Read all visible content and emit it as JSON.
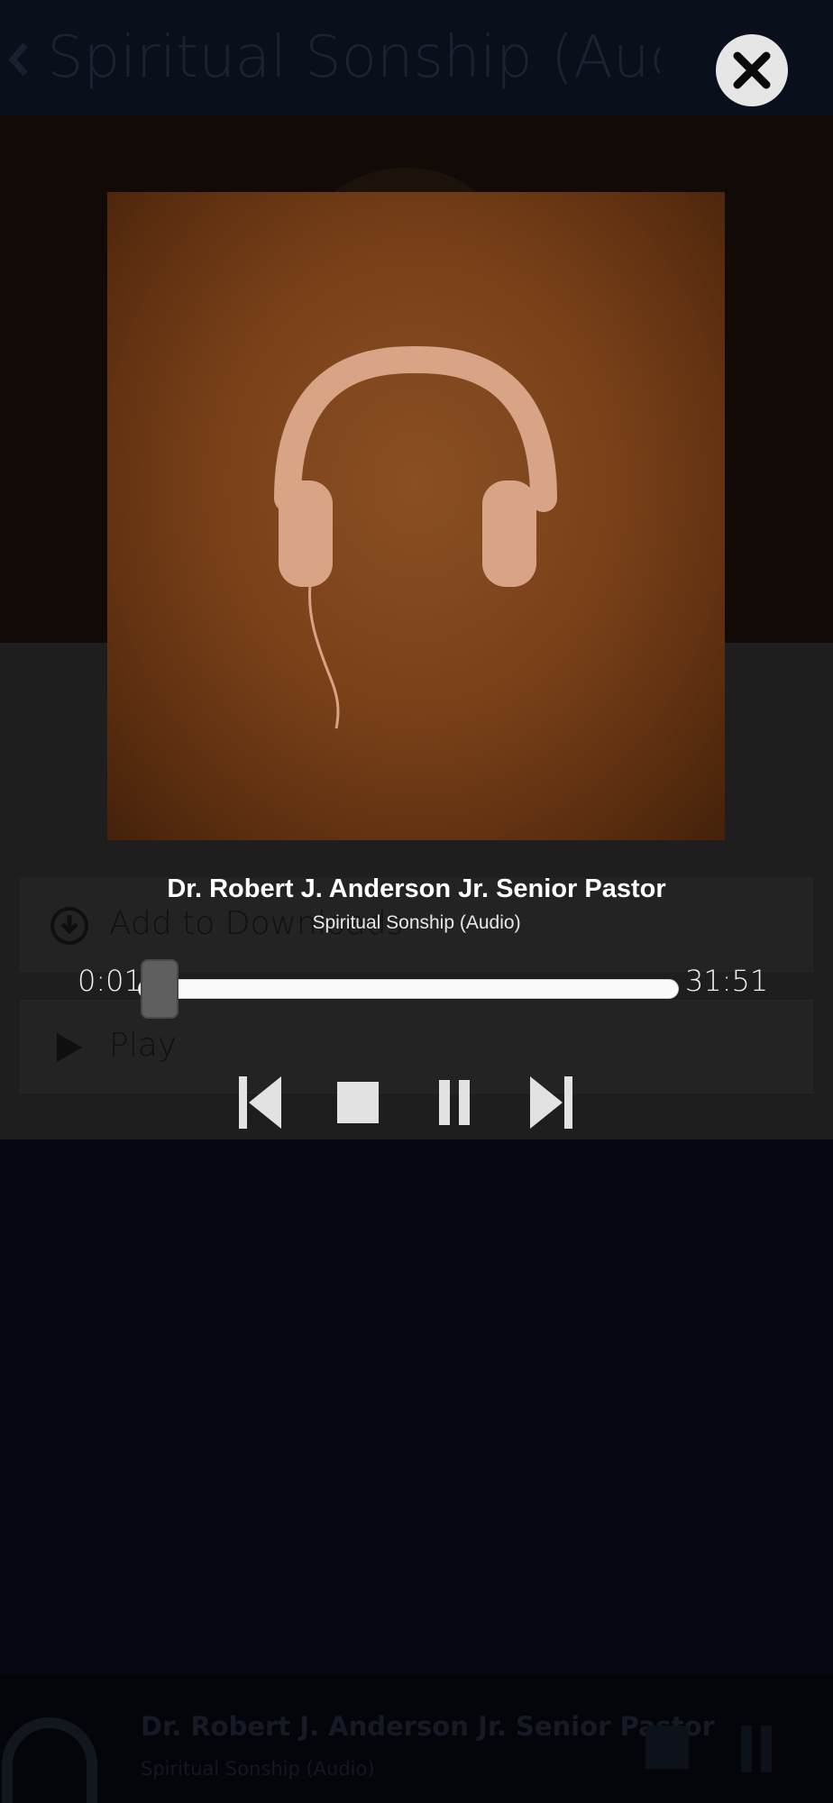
{
  "background_screen": {
    "header_title": "Spiritual Sonship (Audi…",
    "actions": [
      {
        "label": "Add to Downloads",
        "icon": "download-circle-icon"
      },
      {
        "label": "Play",
        "icon": "play-icon"
      }
    ],
    "mini_player": {
      "artist": "Dr. Robert J. Anderson Jr. Senior Pastor",
      "track": "Spiritual Sonship (Audio)"
    }
  },
  "player": {
    "close_icon": "close-icon",
    "artwork_icon": "headphones-icon",
    "artist": "Dr. Robert J. Anderson Jr. Senior Pastor",
    "track": "Spiritual Sonship (Audio)",
    "elapsed": "0:01",
    "duration": "31:51",
    "progress_fraction": 0.0005,
    "controls": [
      {
        "name": "previous",
        "icon": "skip-previous-icon"
      },
      {
        "name": "stop",
        "icon": "stop-icon"
      },
      {
        "name": "pause",
        "icon": "pause-icon"
      },
      {
        "name": "next",
        "icon": "skip-next-icon"
      }
    ]
  },
  "colors": {
    "background": "#050811",
    "artwork_brown": "#7a4119",
    "headphones": "#d9a486",
    "controls": "#e2e2e2",
    "close_button": "#e6e6e6"
  }
}
